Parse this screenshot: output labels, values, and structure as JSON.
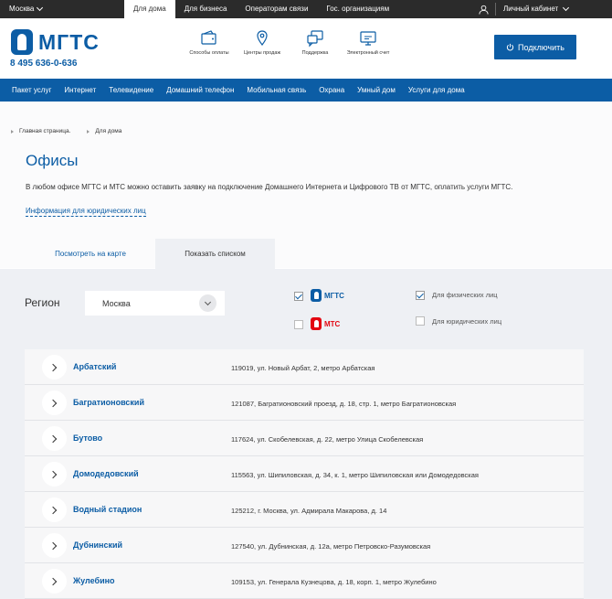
{
  "topbar": {
    "city": "Москва",
    "nav": [
      "Для дома",
      "Для бизнеса",
      "Операторам связи",
      "Гос. организациям"
    ],
    "cabinet": "Личный кабинет"
  },
  "header": {
    "logo": "МГТС",
    "phone": "8 495 636-0-636",
    "icons": [
      {
        "label": "Способы оплаты",
        "icon": "wallet-icon"
      },
      {
        "label": "Центры продаж",
        "icon": "location-pin-icon"
      },
      {
        "label": "Поддержка",
        "icon": "chat-bubble-icon"
      },
      {
        "label": "Электронный счет",
        "icon": "monitor-icon"
      }
    ],
    "connect_label": "Подключить"
  },
  "mainnav": [
    "Пакет услуг",
    "Интернет",
    "Телевидение",
    "Домашний телефон",
    "Мобильная связь",
    "Охрана",
    "Умный дом",
    "Услуги для дома"
  ],
  "breadcrumb": [
    "Главная страница.",
    "Для дома"
  ],
  "page": {
    "title": "Офисы",
    "intro": "В любом офисе МГТС и МТС можно оставить заявку на подключение Домашнего Интернета и Цифрового ТВ от МГТС, оплатить услуги МГТС.",
    "legal_link": "Информация для юридических лиц"
  },
  "tabs": {
    "map": "Посмотреть на карте",
    "list": "Показать списком"
  },
  "filters": {
    "region_label": "Регион",
    "region_value": "Москва",
    "brands": [
      {
        "name": "МГТС",
        "checked": true,
        "color": "#0c5da5"
      },
      {
        "name": "МТС",
        "checked": false,
        "color": "#e30611"
      }
    ],
    "client_types": [
      {
        "label": "Для физических лиц",
        "checked": true
      },
      {
        "label": "Для юридических лиц",
        "checked": false
      }
    ]
  },
  "offices": [
    {
      "name": "Арбатский",
      "address": "119019, ул. Новый Арбат, 2, метро Арбатская"
    },
    {
      "name": "Багратионовский",
      "address": "121087, Багратионовский проезд, д. 18, стр. 1, метро Багратионовская"
    },
    {
      "name": "Бутово",
      "address": "117624, ул. Скобелевская, д. 22, метро Улица Скобелевская"
    },
    {
      "name": "Домодедовский",
      "address": "115563, ул. Шипиловская, д. 34, к. 1, метро Шипиловская или Домодедовская"
    },
    {
      "name": "Водный стадион",
      "address": "125212, г. Москва, ул. Адмирала Макарова, д. 14"
    },
    {
      "name": "Дубнинский",
      "address": "127540, ул. Дубнинская, д. 12а, метро Петровско-Разумовская"
    },
    {
      "name": "Жулебино",
      "address": "109153, ул. Генерала Кузнецова, д. 18, корп. 1, метро Жулебино"
    }
  ]
}
